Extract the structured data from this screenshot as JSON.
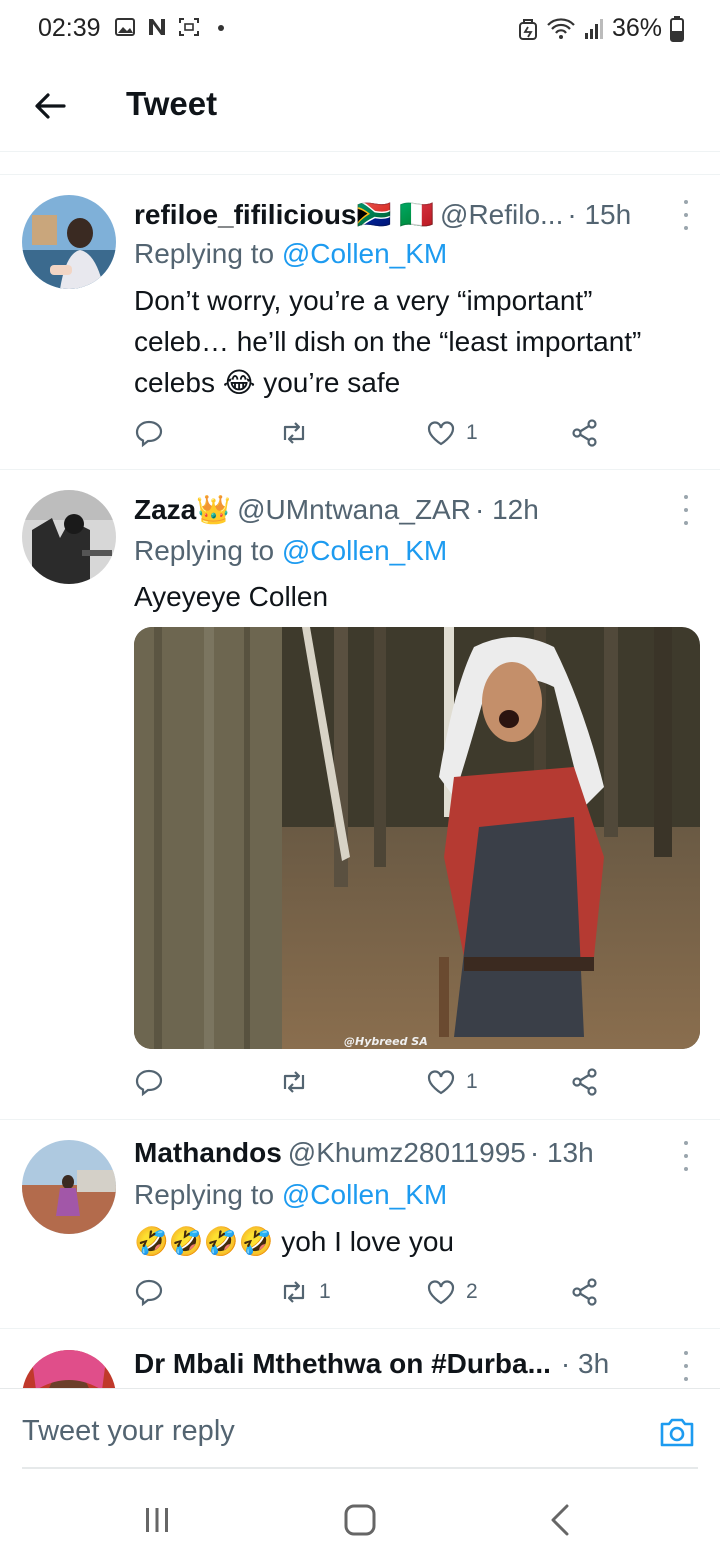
{
  "status_bar": {
    "time": "02:39",
    "battery": "36%"
  },
  "header": {
    "title": "Tweet"
  },
  "tweets": [
    {
      "name": "refiloe_fifilicious🇿🇦 🇮🇹",
      "handle": "@Refilo...",
      "time": "· 15h",
      "replying_prefix": "Replying to",
      "replying_to": "@Collen_KM",
      "body": "Don’t worry, you’re a very “important” celeb… he’ll dish on the “least important” celebs 😂 you’re safe",
      "retweets": "",
      "likes": "1"
    },
    {
      "name": "Zaza👑",
      "handle": "@UMntwana_ZAR",
      "time": "· 12h",
      "replying_prefix": "Replying to",
      "replying_to": "@Collen_KM",
      "body": "Ayeyeye Collen",
      "media_watermark": "@Hybreed SA",
      "retweets": "",
      "likes": "1"
    },
    {
      "name": "Mathandos",
      "handle": "@Khumz28011995",
      "time": "· 13h",
      "replying_prefix": "Replying to",
      "replying_to": "@Collen_KM",
      "body": "🤣🤣🤣🤣 yoh I love you",
      "retweets": "1",
      "likes": "2"
    },
    {
      "name": "Dr Mbali Mthethwa on #Durba...",
      "handle": "",
      "time": "· 3h"
    }
  ],
  "reply_bar": {
    "placeholder": "Tweet your reply"
  },
  "colors": {
    "accent": "#1d9bf0",
    "secondary_text": "#536471"
  }
}
